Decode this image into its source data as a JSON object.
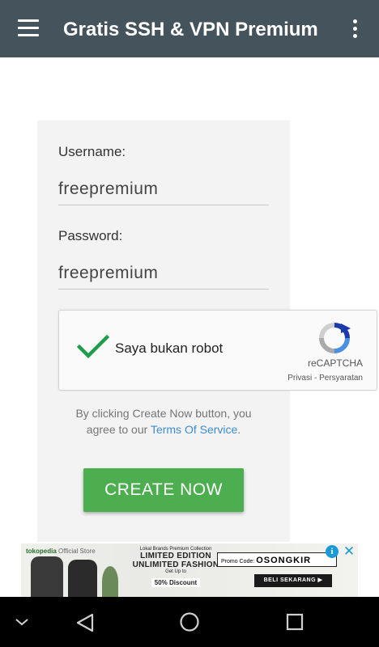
{
  "appbar": {
    "title": "Gratis SSH & VPN Premium",
    "menu_icon": "hamburger-menu-icon",
    "overflow_icon": "more-vert-icon",
    "background": "#45535c"
  },
  "form": {
    "username_label": "Username:",
    "username_value": "freepremium",
    "password_label": "Password:",
    "password_value": "freepremium"
  },
  "captcha": {
    "label": "Saya bukan robot",
    "brand": "reCAPTCHA",
    "links": "Privasi - Persyaratan",
    "checked": true
  },
  "terms": {
    "prefix": "By clicking Create Now button, you agree to our ",
    "link": "Terms Of Service",
    "suffix": "."
  },
  "create_button": {
    "label": "CREATE NOW",
    "color": "#4cae4f"
  },
  "ad": {
    "brand": "tokopedia",
    "brand_sub": "Official Store",
    "line1": "Lokal Brands Premium Collection",
    "line2": "LIMITED EDITION",
    "line3": "UNLIMITED FASHION",
    "line4": "Get Up to",
    "discount": "50% Discount",
    "promo_label": "Promo Code:",
    "promo_code": "OSONGKIR",
    "cta": "BELI SEKARANG ▶",
    "info_icon": "i",
    "close_icon": "✕"
  },
  "navbar": {
    "icons": [
      "chevron-down-icon",
      "back-icon",
      "home-icon",
      "recents-icon"
    ]
  }
}
